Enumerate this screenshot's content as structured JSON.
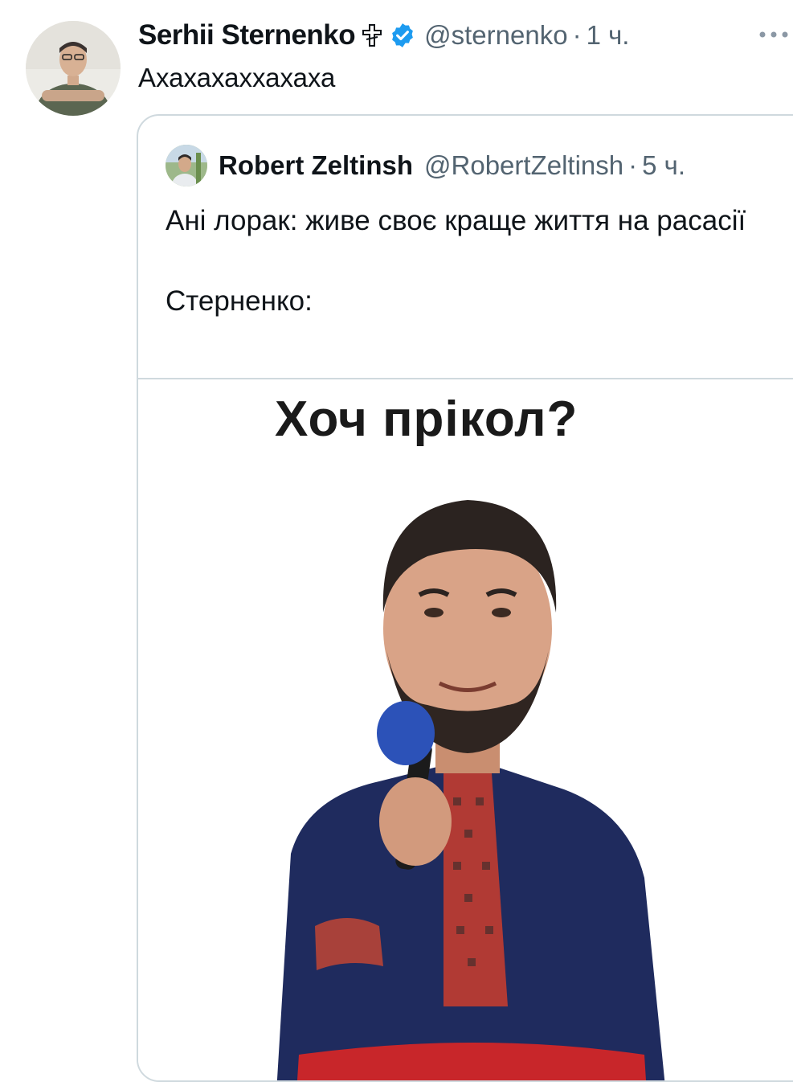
{
  "tweet": {
    "display_name": "Serhii Sternenko",
    "cross_icon": "orthodox-cross-icon",
    "verified_icon": "verified-badge-icon",
    "verified_color": "#1d9bf0",
    "handle": "@sternenko",
    "separator": "·",
    "time": "1 ч.",
    "text": "Ахахахаххахаха",
    "more_icon": "more-dots-icon"
  },
  "quote": {
    "display_name": "Robert Zeltinsh",
    "handle": "@RobertZeltinsh",
    "separator": "·",
    "time": "5 ч.",
    "text": "Ані лорак: живе своє краще життя на расасії\n\nСтерненко:",
    "media": {
      "caption": "Хоч прікол?"
    }
  },
  "colors": {
    "secondary_text": "#536471",
    "border": "#cfd9de",
    "primary_text": "#0f1419"
  }
}
